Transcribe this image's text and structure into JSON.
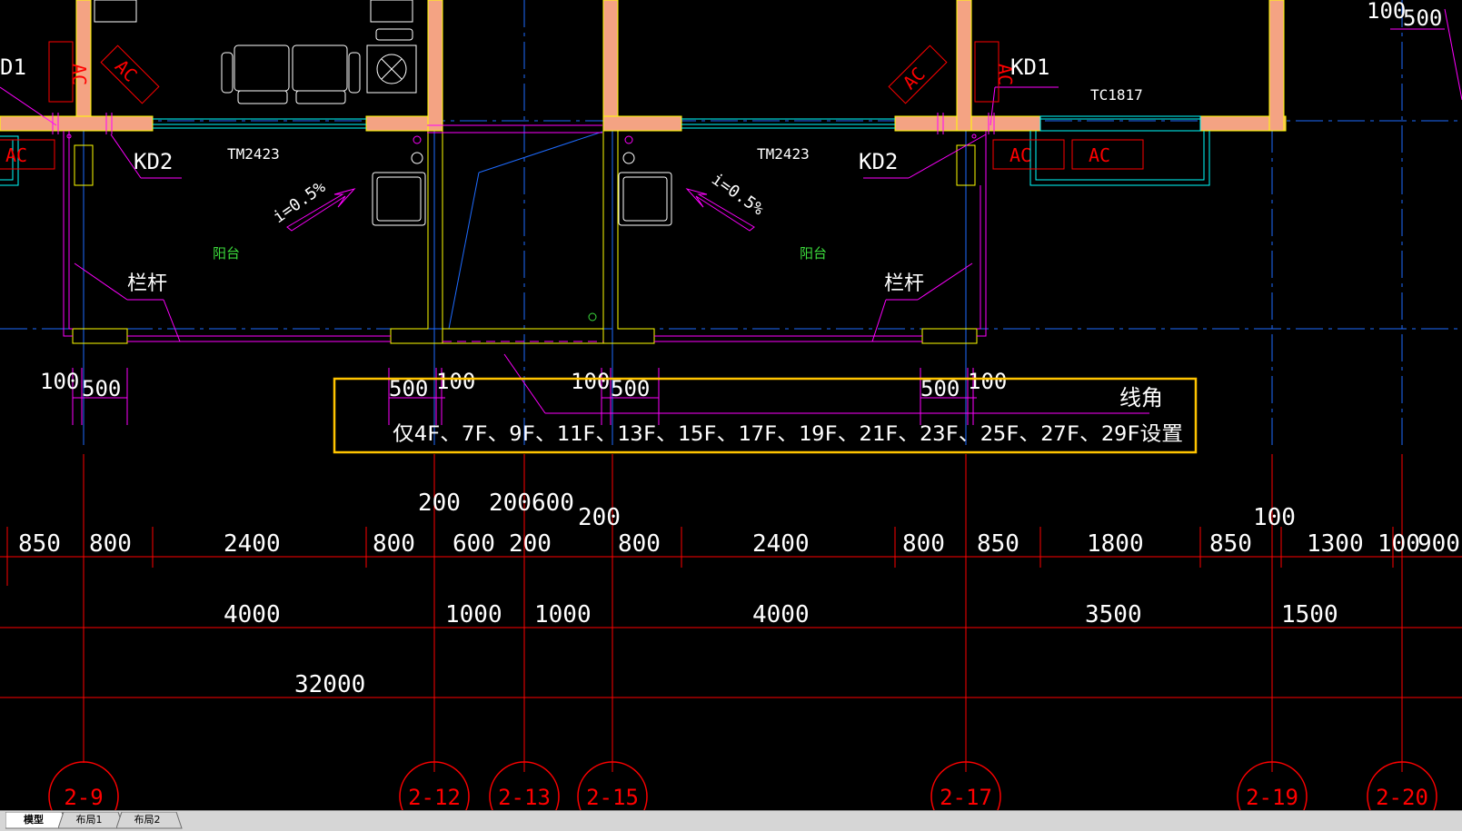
{
  "colors": {
    "background": "#000000",
    "wall": "#f4a383",
    "magenta": "#ff00ff",
    "yellow": "#ffff00",
    "cyan": "#00ffff",
    "red": "#ff0000",
    "blue": "#1e6bff",
    "green": "#3cdc3c",
    "white": "#ffffff",
    "highlight": "#ffc400"
  },
  "labels": {
    "d1_left": "D1",
    "kd1_right": "KD1",
    "kd2_left": "KD2",
    "kd2_right": "KD2",
    "tm_left": "TM2423",
    "tm_right": "TM2423",
    "tc": "TC1817",
    "slope_left": "i=0.5%",
    "slope_right": "i=0.5%",
    "balcony_left": "阳台",
    "balcony_right": "阳台",
    "railing_left": "栏杆",
    "railing_right": "栏杆",
    "ac_tags": [
      "AC",
      "AC",
      "AC",
      "AC",
      "AC",
      "AC",
      "AC",
      "AC"
    ]
  },
  "small_dims": {
    "d100_a": "100",
    "d500_a": "500",
    "d500_b": "500",
    "d100_b": "100",
    "d100_c": "100",
    "d500_c": "500",
    "d500_d": "500",
    "d100_d": "100",
    "d100_top": "100",
    "d500_top": "500"
  },
  "note": {
    "line1": "线角",
    "line2": "仅4F、7F、9F、11F、13F、15F、17F、19F、21F、23F、25F、27F、29F设置"
  },
  "upper_dims": {
    "d200_a": "200",
    "d200600": "200600",
    "d200_b": "200",
    "d100": "100"
  },
  "dim_row1": [
    "850",
    "800",
    "2400",
    "800",
    "600",
    "200",
    "800",
    "2400",
    "800",
    "850",
    "1800",
    "850",
    "1300",
    "100",
    "900"
  ],
  "dim_row2": [
    "4000",
    "1000",
    "1000",
    "4000",
    "3500",
    "1500"
  ],
  "dim_total": "32000",
  "axes": [
    "2-9",
    "2-12",
    "2-13",
    "2-15",
    "2-17",
    "2-19",
    "2-20"
  ],
  "tabs": [
    "模型",
    "布局1",
    "布局2"
  ]
}
